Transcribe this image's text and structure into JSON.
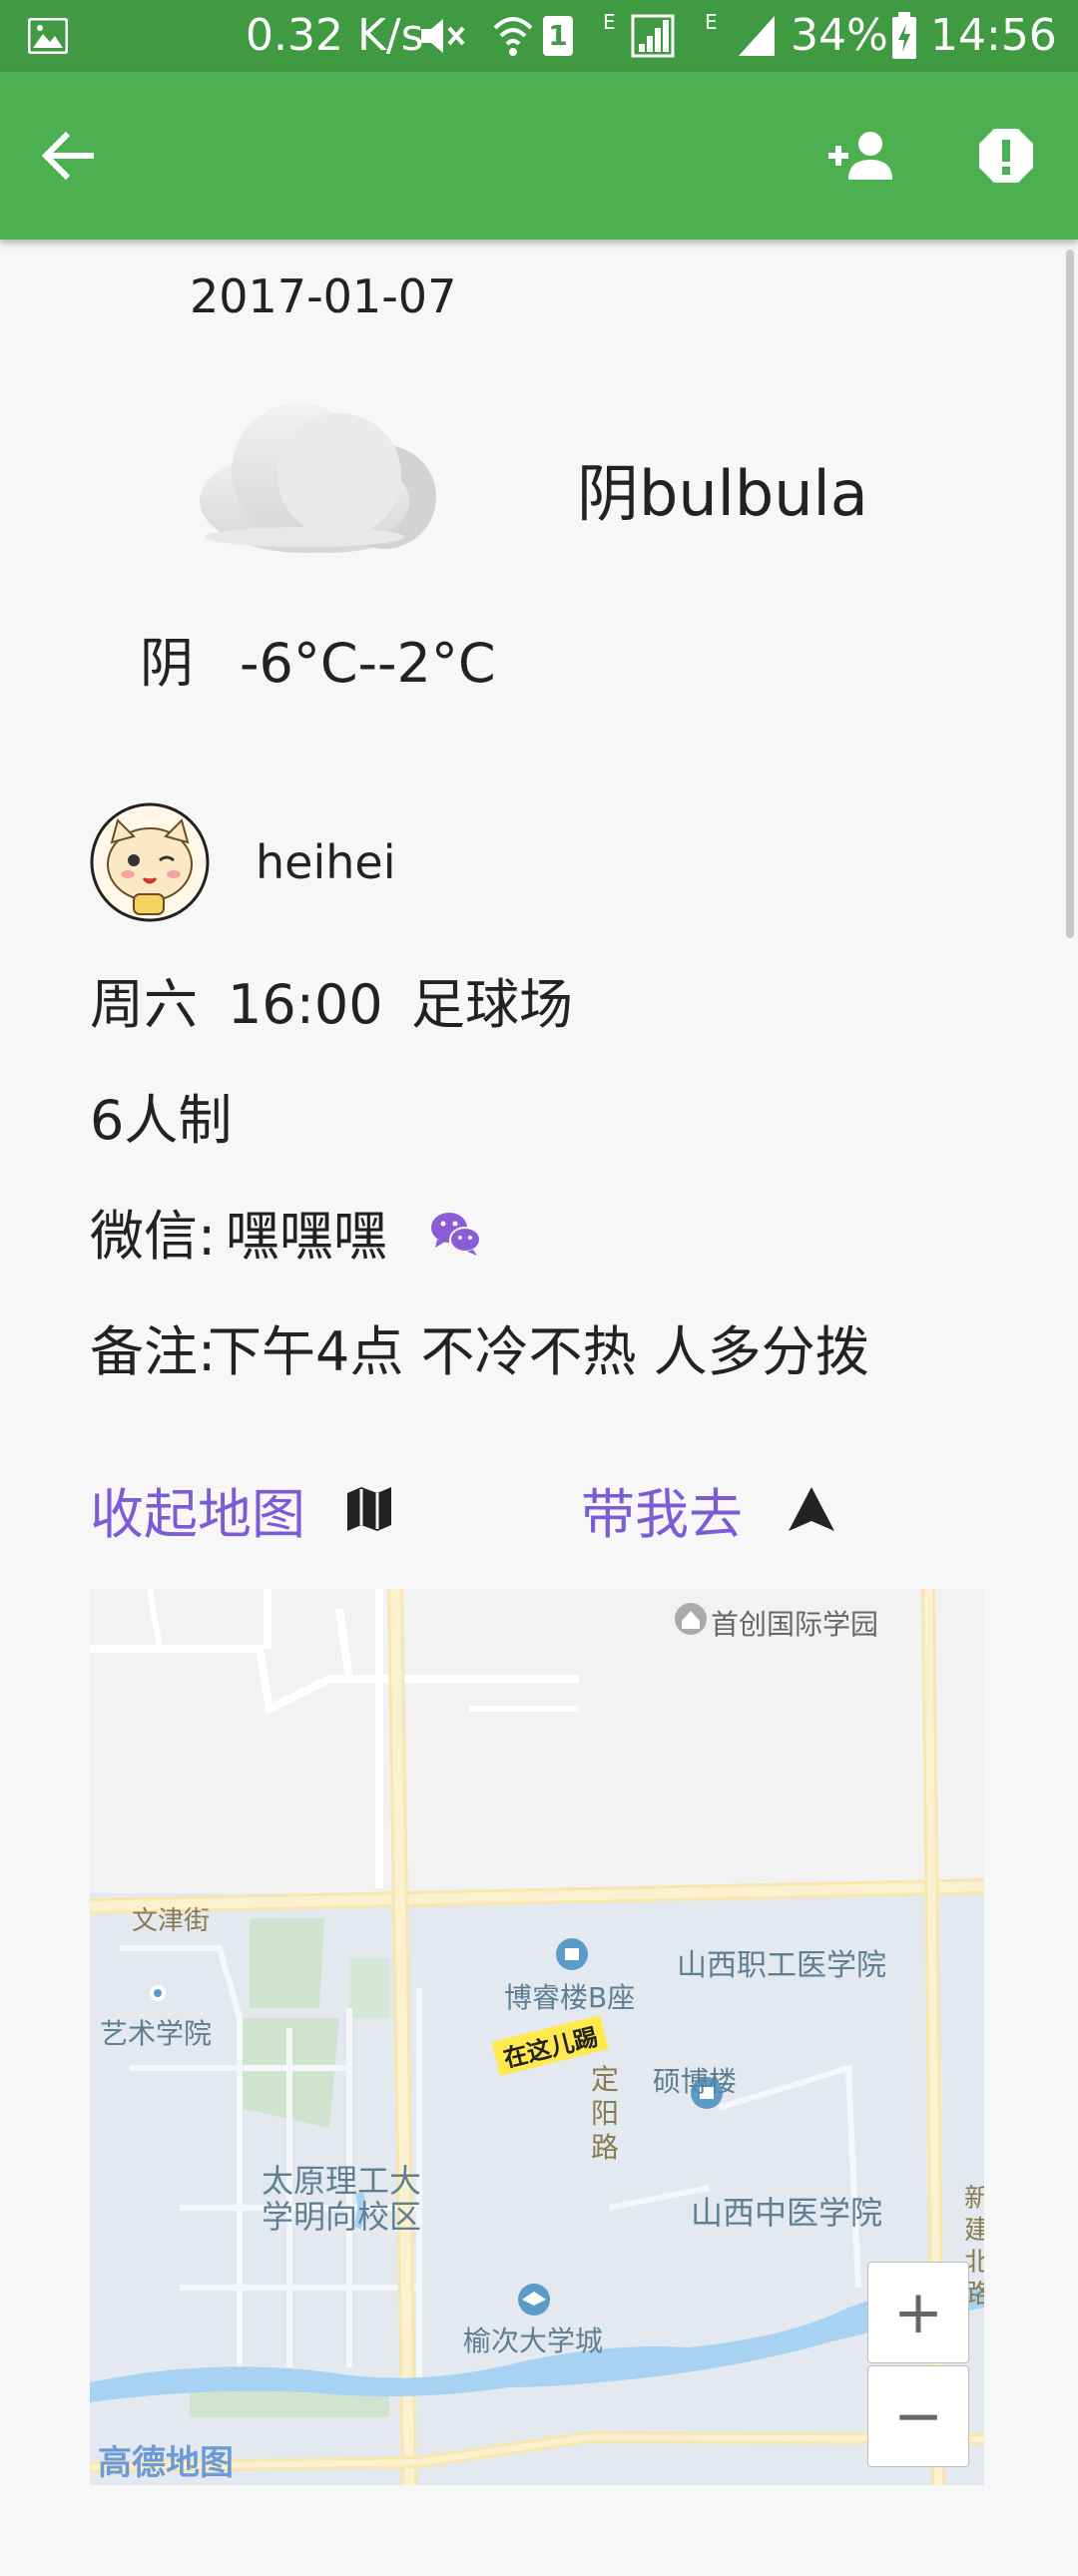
{
  "status_bar": {
    "speed": "0.32 K/s",
    "sim_badge": "1",
    "net1": "E",
    "net2": "E",
    "battery": "34%",
    "time": "14:56"
  },
  "app_bar": {
    "back_icon": "arrow-back-icon",
    "add_friend_icon": "person-add-icon",
    "report_icon": "report-icon"
  },
  "weather": {
    "date": "2017-01-07",
    "condition_with_note": "阴bulbula",
    "condition": "阴",
    "temperature": "-6°C--2°C",
    "icon": "cloud-icon"
  },
  "post": {
    "username": "heihei",
    "day": "周六",
    "time": "16:00",
    "place": "足球场",
    "format": "6人制",
    "wechat_label": "微信:",
    "wechat_value": "嘿嘿嘿",
    "note_label": "备注:",
    "note_value": "下午4点 不冷不热 人多分拨"
  },
  "actions": {
    "collapse_map": "收起地图",
    "navigate": "带我去",
    "accent": "#7c5cd6"
  },
  "map": {
    "labels": {
      "school_top": "首创国际学园",
      "road_wenjin": "文津街",
      "art": "艺术学院",
      "boruilou": "博睿楼B座",
      "marker": "在这儿踢",
      "vocational": "山西职工医学院",
      "shuobo": "硕博楼",
      "road_dingyang_1": "定",
      "road_dingyang_2": "阳",
      "road_dingyang_3": "路",
      "tut_line1": "太原理工大",
      "tut_line2": "学明向校区",
      "tcm": "山西中医学院",
      "edge_1": "新",
      "edge_2": "建",
      "edge_3": "北",
      "edge_4": "路",
      "university_city": "榆次大学城",
      "brand": "高德地图"
    },
    "zoom_in": "+",
    "zoom_out": "−"
  },
  "colors": {
    "status_bar": "#3f9a42",
    "app_bar": "#4caf50"
  }
}
